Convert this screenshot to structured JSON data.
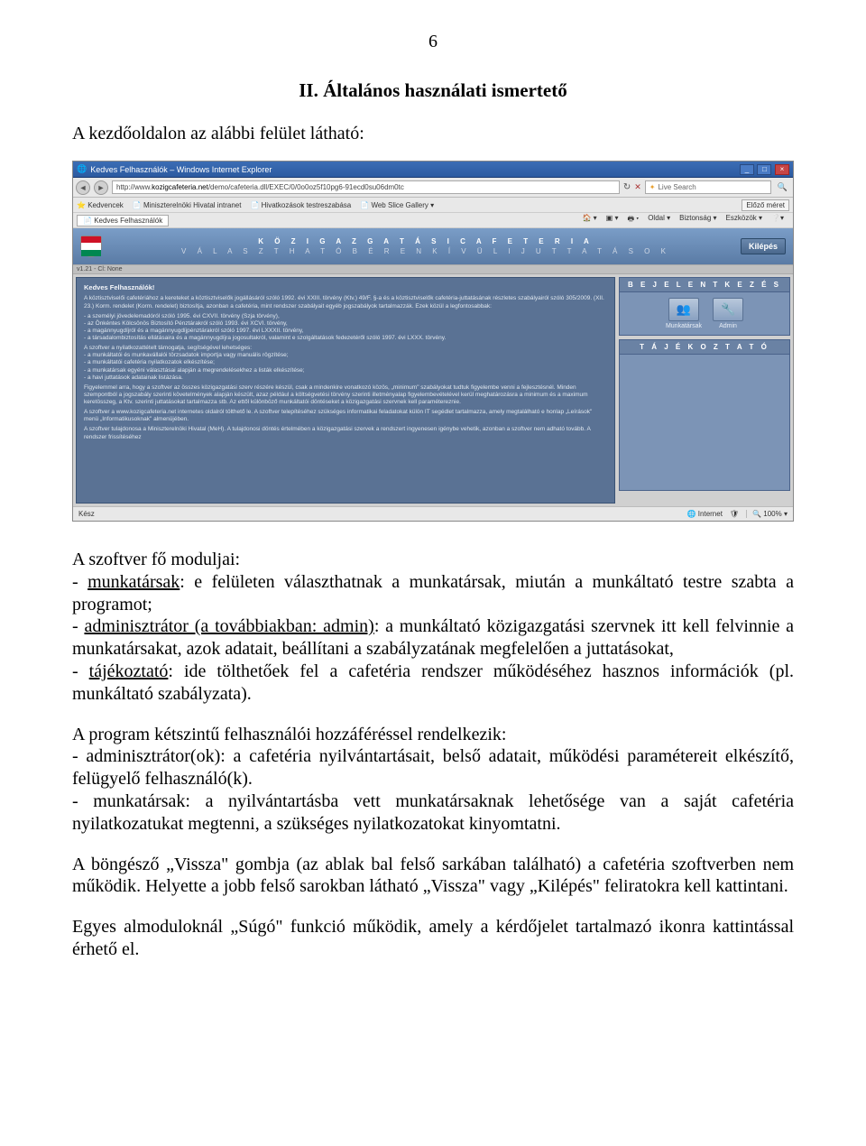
{
  "page": {
    "number": "6",
    "section_title": "II. Általános használati ismertető",
    "intro": "A kezdőoldalon az alábbi felület látható:"
  },
  "screenshot": {
    "window_title": "Kedves Felhasználók – Windows Internet Explorer",
    "address": "http://www.",
    "address_url": "kozigcafeteria.net",
    "address_tail": "/demo/cafeteria.dll/EXEC/0/0o0oz5f10pg6-91ecd0su06dm0tc",
    "fav_label": "Kedvencek",
    "fav_links": [
      "Miniszterelnöki Hivatal intranet",
      "Hivatkozások testreszabása",
      "Web Slice Gallery"
    ],
    "tab_title": "Kedves Felhasználók",
    "search_label": "Live Search",
    "toolbar_right": [
      "Oldal",
      "Biztonság",
      "Eszközök"
    ],
    "side_label": "Előző méret",
    "app_title1": "K Ö Z I G A Z G A T Á S I   C A F E T E R I A",
    "app_title2": "V Á L A S Z T H A T Ó   B É R E N   K Í V Ü L I   J U T T A T Á S O K",
    "kilepes": "Kilépés",
    "version": "v1.21 - Cl: None",
    "panel_greeting": "Kedves Felhasználók!",
    "panel_paragraphs": [
      "A köztisztviselői cafetériához a kereteket a köztisztviselők jogállásáról szóló 1992. évi XXIII. törvény (Ktv.) 49/F. §-a és a köztisztviselők cafetéria-juttatásának részletes szabályairól szóló 305/2009. (XII. 23.) Korm. rendelet (Korm. rendelet) biztosítja, azonban a cafetéria, mint rendszer szabályait egyéb jogszabályok tartalmazzák. Ezek közül a legfontosabbak:",
      "- a személyi jövedelemadóról szóló 1995. évi CXVII. törvény (Szja törvény),\n- az Önkéntes Kölcsönös Biztosító Pénztárakról szóló 1993. évi XCVI. törvény,\n- a magánnyugdíjról és a magánnyugdíjpénztárakról szóló 1997. évi LXXXII. törvény,\n- a társadalombiztosítás ellátásaira és a magánnyugdíjra jogosultakról, valamint e szolgáltatások fedezetéről szóló 1997. évi LXXX. törvény.",
      "A szoftver a nyilatkozattételt támogatja, segítségével lehetséges:\n- a munkáltatói és munkavállalói törzsadatok importja vagy manuális rögzítése;\n- a munkáltatói cafetéria nyilatkozatok elkészítése;\n- a munkatársak egyéni választásai alapján a megrendelésekhez a listák elkészítése;\n- a havi juttatások adatainak listázása.",
      "Figyelemmel arra, hogy a szoftver az összes közigazgatási szerv részére készül, csak a mindenkire vonatkozó közös, „minimum\" szabályokat tudtuk figyelembe venni a fejlesztésnél. Minden szempontból a jogszabály szerinti követelmények alapján készült, azaz például a költségvetési törvény szerinti illetményalap figyelembevételével kerül meghatározásra a minimum és a maximum keretösszeg, a Ktv. szerinti juttatásokat tartalmazza stb. Az ettől különböző munkáltatói döntéseket a közigazgatási szervnek kell paramétereznie.",
      "A szoftver a www.kozigcafeteria.net internetes oldalról tölthető le. A szoftver telepítéséhez szükséges informatikai feladatokat külön IT segédlet tartalmazza, amely megtalálható e honlap „Leírások\" menü „Informatikusoknak\" almenüjében.",
      "A szoftver tulajdonosa a Miniszterelnöki Hivatal (MeH). A tulajdonosi döntés értelmében a közigazgatási szervek a rendszert ingyenesen igénybe vehetik, azonban a szoftver nem adható tovább. A rendszer frissítéséhez"
    ],
    "login_header": "B E J E L E N T K E Z É S",
    "login_items": [
      {
        "label": "Munkatársak"
      },
      {
        "label": "Admin"
      }
    ],
    "info_header": "T Á J É K O Z T A T Ó",
    "status_left": "Kész",
    "status_net": "Internet",
    "status_zoom": "100%"
  },
  "doc": {
    "modules_title": "A szoftver fő moduljai:",
    "mod1_pre": "- ",
    "mod1_u": "munkatársak",
    "mod1_post": ": e felületen választhatnak a munkatársak, miután a munkáltató testre szabta a programot;",
    "mod2_pre": "- ",
    "mod2_u": "adminisztrátor (a továbbiakban: admin)",
    "mod2_post": ": a munkáltató közigazgatási szervnek itt kell felvinnie a munkatársakat, azok adatait, beállítani a szabályzatának megfelelően a juttatásokat,",
    "mod3_pre": "- ",
    "mod3_u": "tájékoztató",
    "mod3_post": ": ide tölthetőek fel a cafetéria rendszer működéséhez hasznos információk (pl. munkáltató szabályzata).",
    "para2": "A program kétszintű felhasználói hozzáféréssel rendelkezik:\n- adminisztrátor(ok): a cafetéria nyilvántartásait, belső adatait, működési paramétereit elkészítő, felügyelő felhasználó(k).\n- munkatársak: a nyilvántartásba vett munkatársaknak lehetősége van a saját cafetéria nyilatkozatukat megtenni, a szükséges nyilatkozatokat kinyomtatni.",
    "para3": "A böngésző „Vissza\" gombja (az ablak bal felső sarkában található) a cafetéria szoftverben nem működik. Helyette a jobb felső sarokban látható „Vissza\" vagy „Kilépés\" feliratokra kell kattintani.",
    "para4": "Egyes almoduloknál „Súgó\" funkció működik, amely a kérdőjelet tartalmazó ikonra kattintással érhető el."
  }
}
